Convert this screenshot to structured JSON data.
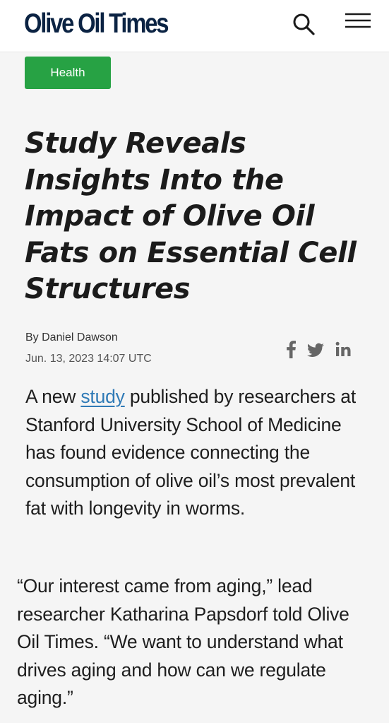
{
  "header": {
    "logo_text": "Olive Oil Times",
    "search_icon": "search-icon",
    "menu_icon": "hamburger-menu-icon"
  },
  "article": {
    "category": "Health",
    "title": "Study Reveals Insights Into the Impact of Olive Oil Fats on Essential Cell Structures",
    "byline_prefix": "By ",
    "author": "Daniel Dawson",
    "date": "Jun. 13, 2023 14:07 UTC",
    "share_icons": [
      "facebook-icon",
      "twitter-icon",
      "linkedin-icon"
    ],
    "paragraphs": [
      {
        "before": "A new ",
        "link": "study",
        "after": " published by researchers at Stanford University School of Medicine has found evi­dence connecting the consumption of olive oil’s most prevalent fat with longevity in worms."
      },
      {
        "text": "“Our interest came from aging,” lead researcher Katharina Papsdorf told Olive Oil Times. “We want to under­stand what drives aging and how can we regulate aging.”"
      }
    ]
  },
  "colors": {
    "logo": "#0b2343",
    "category_badge": "#27a244",
    "link": "#2f7ab6",
    "share_icons": "#666666"
  }
}
